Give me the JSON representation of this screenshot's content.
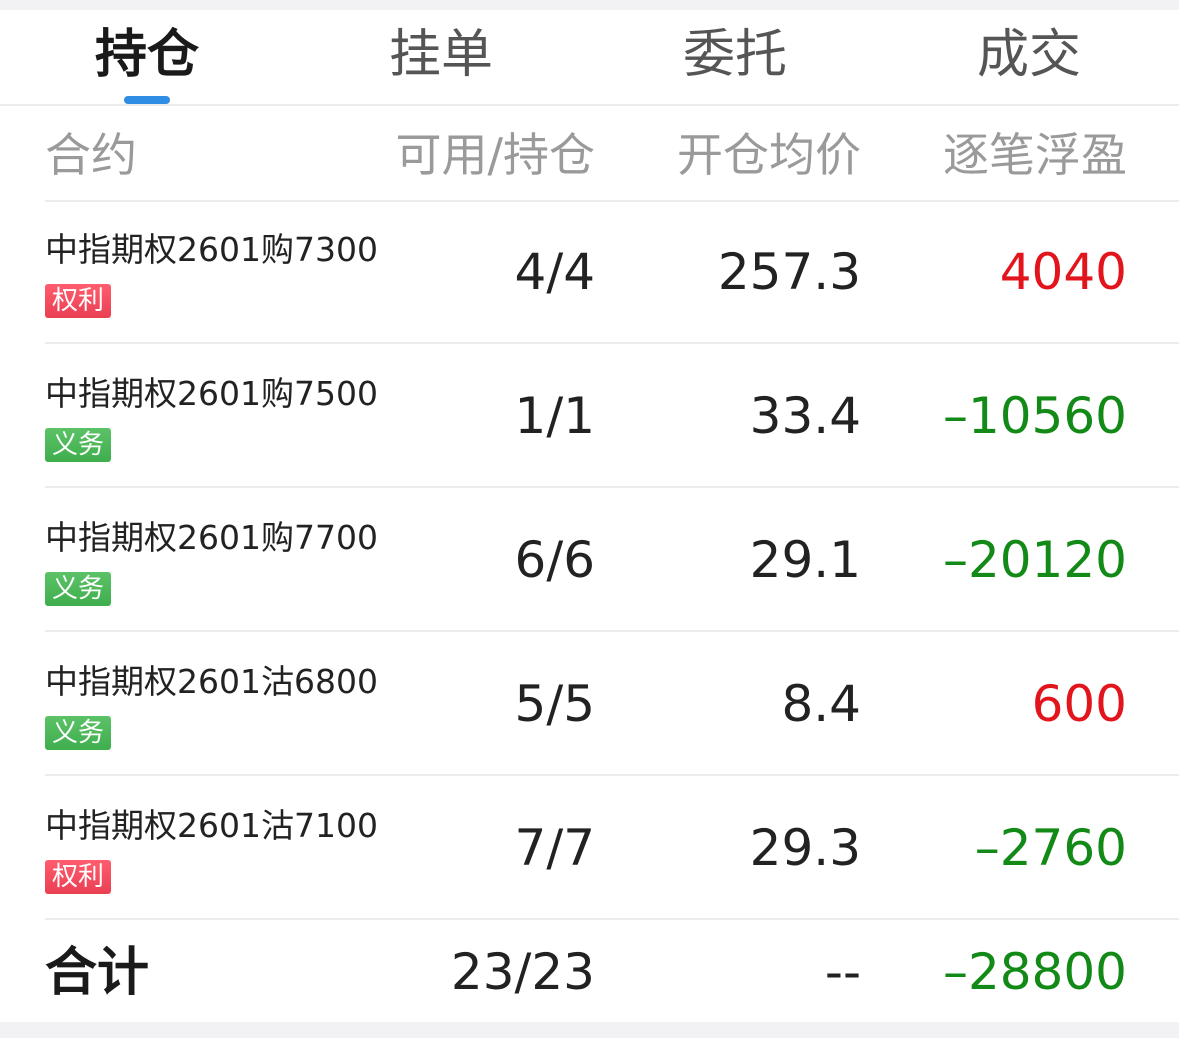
{
  "tabs": [
    {
      "label": "持仓",
      "active": true
    },
    {
      "label": "挂单",
      "active": false
    },
    {
      "label": "委托",
      "active": false
    },
    {
      "label": "成交",
      "active": false
    }
  ],
  "columns": {
    "contract": "合约",
    "available_position": "可用/持仓",
    "open_avg_price": "开仓均价",
    "float_pl": "逐笔浮盈"
  },
  "rows": [
    {
      "name": "中指期权2601购7300",
      "badge": "权利",
      "badge_type": "quanli",
      "avail": "4/4",
      "price": "257.3",
      "pl": "4040",
      "pl_dir": "up"
    },
    {
      "name": "中指期权2601购7500",
      "badge": "义务",
      "badge_type": "yiwu",
      "avail": "1/1",
      "price": "33.4",
      "pl": "–10560",
      "pl_dir": "down"
    },
    {
      "name": "中指期权2601购7700",
      "badge": "义务",
      "badge_type": "yiwu",
      "avail": "6/6",
      "price": "29.1",
      "pl": "–20120",
      "pl_dir": "down"
    },
    {
      "name": "中指期权2601沽6800",
      "badge": "义务",
      "badge_type": "yiwu",
      "avail": "5/5",
      "price": "8.4",
      "pl": "600",
      "pl_dir": "up"
    },
    {
      "name": "中指期权2601沽7100",
      "badge": "权利",
      "badge_type": "quanli",
      "avail": "7/7",
      "price": "29.3",
      "pl": "–2760",
      "pl_dir": "down"
    }
  ],
  "total": {
    "label": "合计",
    "avail": "23/23",
    "price": "--",
    "pl": "–28800"
  },
  "colors": {
    "accent": "#2f8de4",
    "up": "#e2141c",
    "down": "#138a17",
    "badge_quanli": "#e93f52",
    "badge_yiwu": "#3fae4d"
  }
}
